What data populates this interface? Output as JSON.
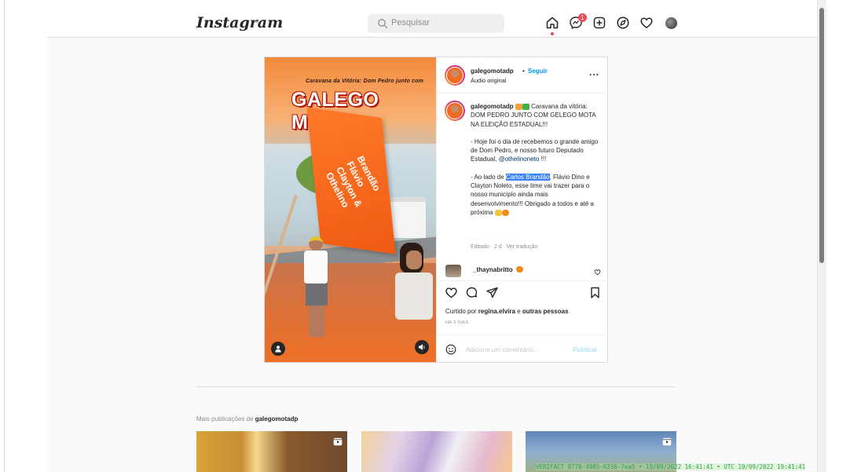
{
  "header": {
    "logo": "Instagram",
    "logo_menu_icon": "chevron-down-icon",
    "search_placeholder": "Pesquisar",
    "messages_badge": "1",
    "icons": [
      "home-icon",
      "messenger-icon",
      "new-post-icon",
      "explore-icon",
      "activity-heart-icon",
      "profile-avatar"
    ]
  },
  "post": {
    "media": {
      "title_small": "Caravana da Vitória: Dom Pedro junto com",
      "title_big": "GALEGO MOTA",
      "flag_text": "Brandão Flávio Clayton & Othelino"
    },
    "author": {
      "username": "galegomotadp",
      "separator": "•",
      "follow_label": "Seguir",
      "audio_label": "Áudio original",
      "more_label": "..."
    },
    "caption": {
      "username": "galegomotadp",
      "p1": "Caravana da vitória: DOM PEDRO JUNTO COM GELEGO MOTA NA ELEIÇÃO ESTADUAL!!!",
      "p2": "- Hoje foi o dia de recebemos o grande amigo de Dom Pedro, e nosso futuro Deputado Estadual,",
      "p2_mention": "@othelinoneto",
      "p2_end": " !!!",
      "p3_start": "- Ao lado de ",
      "p3_highlight": "Carlos Brandão",
      "p3_rest": ", Flávio Dino e Clayton Noleto, esse time vai trazer para o nosso município ainda mais desenvolvimento!!! Obrigado a todos e até a próxima",
      "edited": "Editado · 2 d",
      "translate": "Ver tradução"
    },
    "comment": {
      "username": "_thaynabritto"
    },
    "actions": {
      "liked_prefix": "Curtido por ",
      "liked_user": "regina.elvira",
      "liked_mid": " e ",
      "liked_others": "outras pessoas",
      "time_ago": "HÁ 2 DIAS",
      "comment_placeholder": "Adicione um comentário...",
      "publish_label": "Publicar"
    }
  },
  "more_posts": {
    "label_prefix": "Mais publicações de ",
    "username": "galegomotadp"
  },
  "watermark": "VERIFACT 8778-4985-6336-7ea5 • 19/09/2022 16:41:41 • UTC 19/09/2022 19:41:41",
  "colors": {
    "accent_blue": "#0095f6",
    "notification_red": "#ed4956",
    "watermark_green": "#2fa34a"
  }
}
